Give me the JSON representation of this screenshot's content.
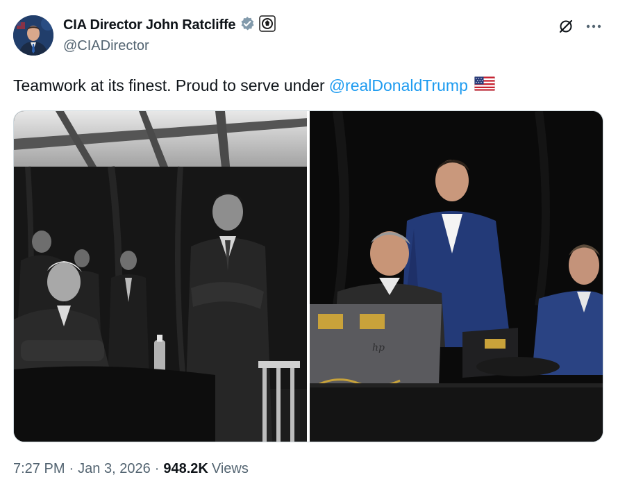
{
  "author": {
    "display_name": "CIA Director John Ratcliffe",
    "handle": "@CIADirector",
    "verified_badge_icon": "verified-badge-icon",
    "affiliation_icon": "cia-seal-icon"
  },
  "actions": {
    "grok_icon": "grok-icon",
    "more_icon": "more-options-icon"
  },
  "tweet": {
    "text": "Teamwork at its finest. Proud to serve under",
    "mention": "@realDonaldTrump",
    "emoji": "us-flag-icon"
  },
  "media": {
    "photo_count": 2,
    "left_style": "black-and-white",
    "right_style": "color"
  },
  "meta": {
    "time": "7:27 PM",
    "separator": "·",
    "date": "Jan 3, 2026",
    "views_count": "948.2K",
    "views_label": "Views"
  },
  "colors": {
    "accent": "#1d9bf0",
    "secondary_text": "#536471",
    "primary_text": "#0f1419",
    "verified_gray": "#829aab"
  }
}
